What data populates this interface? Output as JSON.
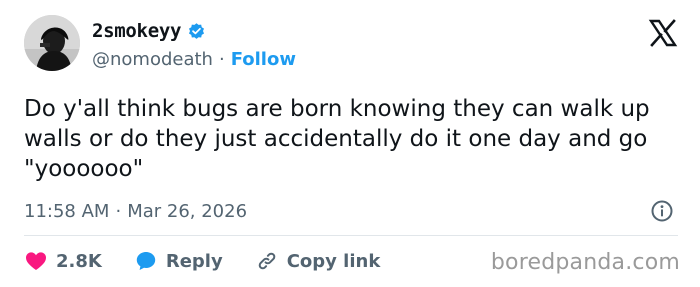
{
  "author": {
    "display_name": "2smokeyy",
    "handle": "@nomodeath",
    "separator": "·",
    "follow_label": "Follow"
  },
  "tweet": {
    "text": "Do y'all think bugs are born knowing they can walk up walls or do they just accidentally do it one day and go \"yoooooo\"",
    "time": "11:58 AM",
    "date_separator": "·",
    "date": "Mar 26, 2026"
  },
  "actions": {
    "like_count": "2.8K",
    "reply_label": "Reply",
    "copy_link_label": "Copy link"
  },
  "watermark": "boredpanda.com",
  "colors": {
    "accent": "#1d9bf0",
    "like": "#f91880",
    "muted": "#536471",
    "text": "#0f1419"
  },
  "icons": {
    "verified": "verified-badge-icon",
    "platform": "x-logo-icon",
    "info": "info-icon",
    "like": "heart-icon",
    "reply": "speech-bubble-icon",
    "copy": "link-icon"
  }
}
